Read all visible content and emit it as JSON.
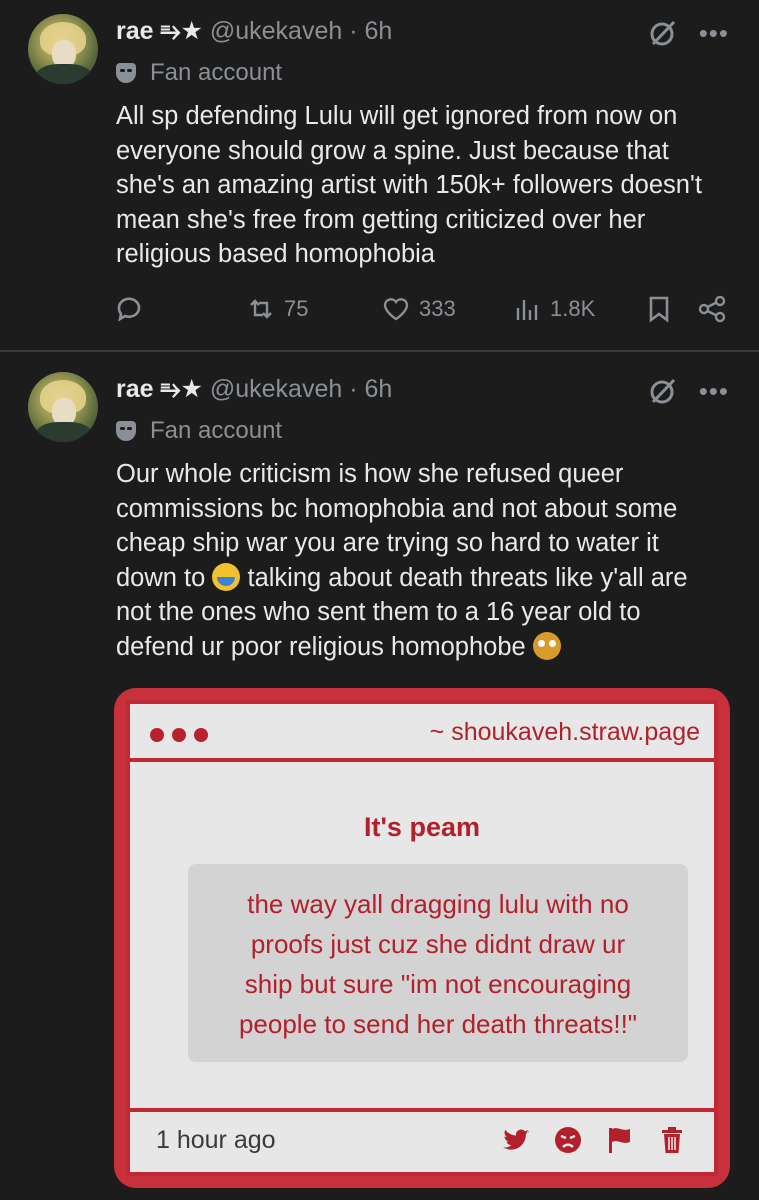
{
  "posts": [
    {
      "display_name": "rae ⥱★",
      "handle": "@ukekaveh",
      "time": "· 6h",
      "label": "Fan account",
      "text_lines": [
        "All sp defending Lulu will get ignored from now on",
        "everyone should grow a spine. Just because that",
        "she's an amazing artist with 150k+ followers doesn't",
        "mean she's free from getting criticized over her",
        "religious based homophobia"
      ],
      "stats": {
        "reposts": "75",
        "likes": "333",
        "views": "1.8K"
      }
    },
    {
      "display_name": "rae ⥱★",
      "handle": "@ukekaveh",
      "time": "· 6h",
      "label": "Fan account",
      "text_lines": [
        "Our whole criticism is how she refused queer",
        "commissions bc homophobia and not about some",
        "cheap ship war you are trying so hard to water it",
        "down to",
        "talking about death threats like y'all are",
        "not the ones who sent them to a 16 year old to",
        "defend ur poor religious homophobe"
      ],
      "embed": {
        "url": "~ shoukaveh.straw.page",
        "title": "It's peam",
        "quote_lines": [
          "the way yall dragging lulu with no",
          "proofs just cuz she didnt draw ur",
          "ship but sure \"im not encouraging",
          "people to send her death threats!!\""
        ],
        "time_ago": "1 hour ago"
      }
    }
  ],
  "icons": {
    "reply": "reply-icon",
    "repost": "repost-icon",
    "like": "heart-icon",
    "views": "views-icon",
    "bookmark": "bookmark-icon",
    "share": "share-icon",
    "grok": "grok-icon",
    "more": "more-icon",
    "embed_icons": [
      "twitter-bird-icon",
      "angry-face-icon",
      "flag-icon",
      "trash-icon"
    ]
  },
  "colors": {
    "background": "#1c1c1c",
    "muted": "#8b9096",
    "embed_accent": "#c02a37"
  }
}
